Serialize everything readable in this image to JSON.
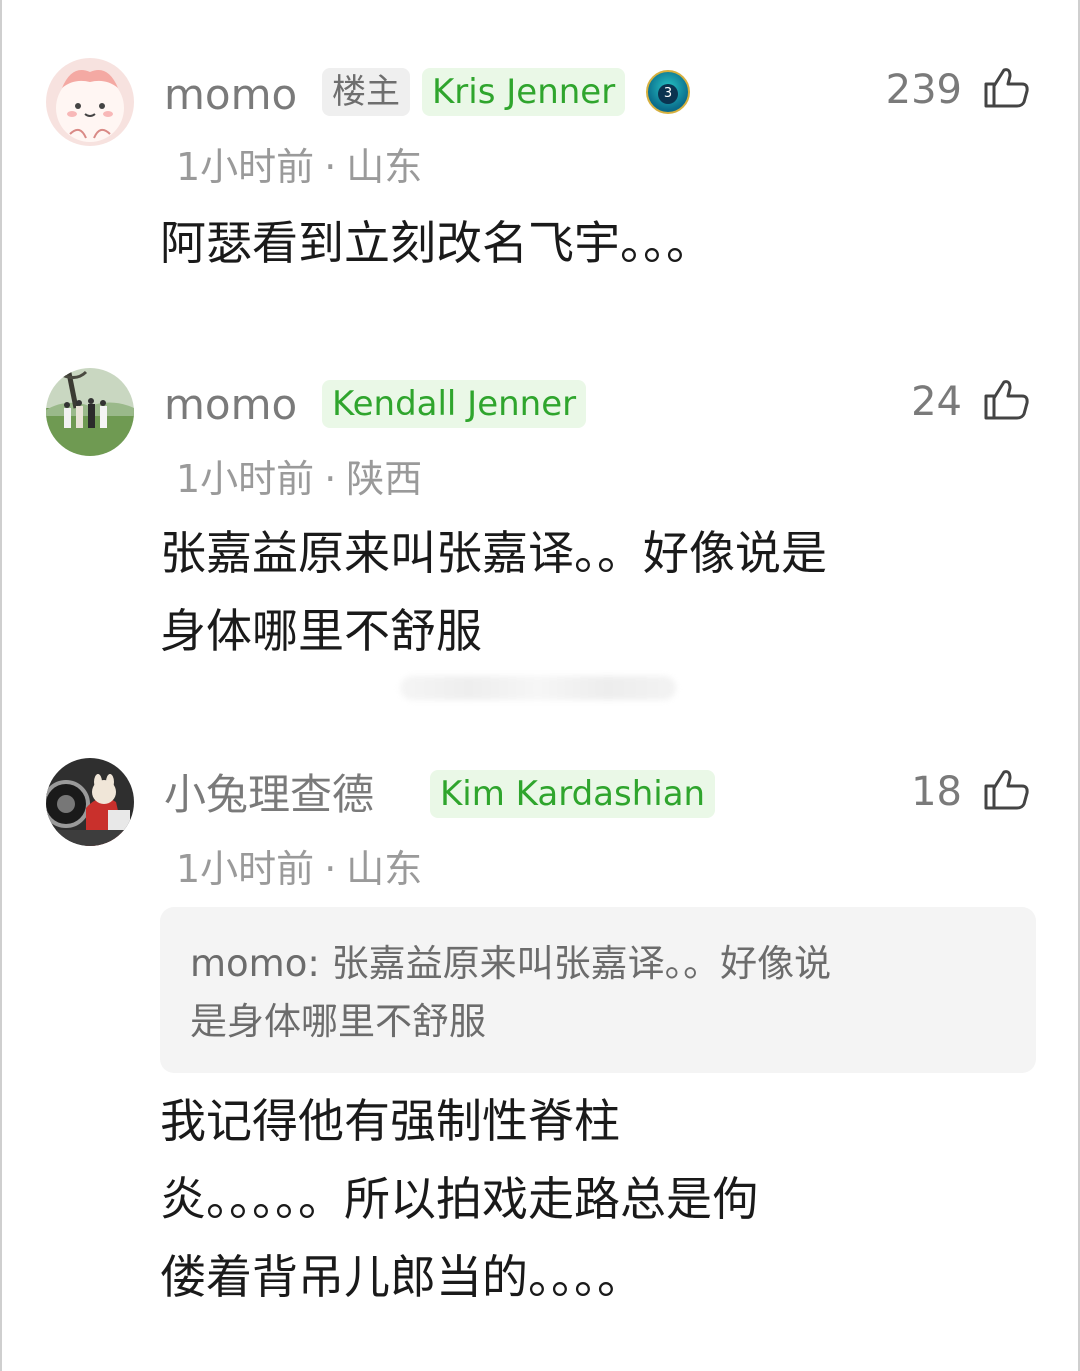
{
  "comments": [
    {
      "username": "momo",
      "role_tag": "楼主",
      "medal": "Kris Jenner",
      "level": "3",
      "likes": "239",
      "time": "1小时前",
      "location": "山东",
      "text": "阿瑟看到立刻改名飞宇。。。"
    },
    {
      "username": "momo",
      "medal": "Kendall Jenner",
      "likes": "24",
      "time": "1小时前",
      "location": "陕西",
      "text_line1": "张嘉益原来叫张嘉译。。好像说是",
      "text_line2": "身体哪里不舒服"
    },
    {
      "username": "小兔理查德",
      "medal": "Kim Kardashian",
      "likes": "18",
      "time": "1小时前",
      "location": "山东",
      "quote_line1": "momo: 张嘉益原来叫张嘉译。。好像说",
      "quote_line2": "是身体哪里不舒服",
      "text_line1": "我记得他有强制性脊柱",
      "text_line2": "炎。。。。。所以拍戏走路总是佝",
      "text_line3": "偻着背吊儿郎当的。。。。"
    }
  ],
  "separator": "·",
  "colors": {
    "medal_bg": "#eaf8e7",
    "medal_text": "#2fa52d",
    "role_bg": "#efefef",
    "secondary_text": "#9a9a9a"
  }
}
